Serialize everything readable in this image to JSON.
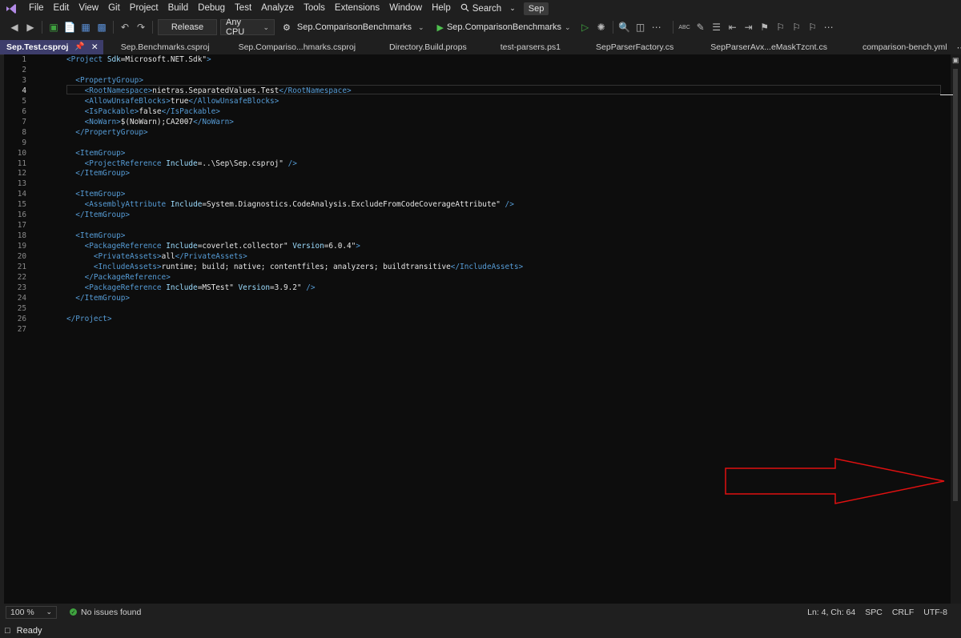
{
  "menu": [
    "File",
    "Edit",
    "View",
    "Git",
    "Project",
    "Build",
    "Debug",
    "Test",
    "Analyze",
    "Tools",
    "Extensions",
    "Window",
    "Help"
  ],
  "search_label": "Search",
  "solution_name": "Sep",
  "toolbar": {
    "configuration": "Release",
    "platform": "Any CPU",
    "startup_project": "Sep.ComparisonBenchmarks",
    "run_target": "Sep.ComparisonBenchmarks"
  },
  "tabs": [
    {
      "label": "Sep.Test.csproj",
      "active": true
    },
    {
      "label": "Sep.Benchmarks.csproj"
    },
    {
      "label": "Sep.Compariso...hmarks.csproj"
    },
    {
      "label": "Directory.Build.props"
    },
    {
      "label": "test-parsers.ps1"
    },
    {
      "label": "SepParserFactory.cs"
    },
    {
      "label": "SepParserAvx...eMaskTzcnt.cs"
    },
    {
      "label": "comparison-bench.yml"
    }
  ],
  "code": {
    "current_line": 4,
    "line_numbers": [
      "1",
      "2",
      "3",
      "4",
      "5",
      "6",
      "7",
      "8",
      "9",
      "10",
      "11",
      "12",
      "13",
      "14",
      "15",
      "16",
      "17",
      "18",
      "19",
      "20",
      "21",
      "22",
      "23",
      "24",
      "25",
      "26",
      "27"
    ],
    "lines": [
      "<Project Sdk=\"Microsoft.NET.Sdk\">",
      "",
      "  <PropertyGroup>",
      "    <RootNamespace>nietras.SeparatedValues.Test</RootNamespace>",
      "    <AllowUnsafeBlocks>true</AllowUnsafeBlocks>",
      "    <IsPackable>false</IsPackable>",
      "    <NoWarn>$(NoWarn);CA2007</NoWarn>",
      "  </PropertyGroup>",
      "",
      "  <ItemGroup>",
      "    <ProjectReference Include=\"..\\Sep\\Sep.csproj\" />",
      "  </ItemGroup>",
      "",
      "  <ItemGroup>",
      "    <AssemblyAttribute Include=\"System.Diagnostics.CodeAnalysis.ExcludeFromCodeCoverageAttribute\" />",
      "  </ItemGroup>",
      "",
      "  <ItemGroup>",
      "    <PackageReference Include=\"coverlet.collector\" Version=\"6.0.4\">",
      "      <PrivateAssets>all</PrivateAssets>",
      "      <IncludeAssets>runtime; build; native; contentfiles; analyzers; buildtransitive</IncludeAssets>",
      "    </PackageReference>",
      "    <PackageReference Include=\"MSTest\" Version=\"3.9.2\" />",
      "  </ItemGroup>",
      "",
      "</Project>",
      ""
    ]
  },
  "status": {
    "zoom": "100 %",
    "issues": "No issues found",
    "position": "Ln: 4, Ch: 64",
    "indent": "SPC",
    "line_ending": "CRLF",
    "encoding": "UTF-8"
  },
  "app_status": "Ready",
  "colors": {
    "tag": "#569cd6",
    "attr": "#9cdcfe",
    "text": "#e6e6e6",
    "active_tab": "#3d3d6b",
    "annotation_arrow": "#e01010"
  }
}
